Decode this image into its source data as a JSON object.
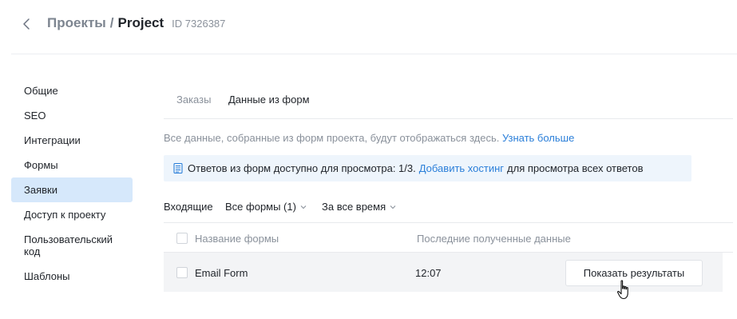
{
  "header": {
    "back_icon": "chevron-left-icon",
    "breadcrumb_parent": "Проекты",
    "breadcrumb_separator": "/",
    "breadcrumb_current": "Project",
    "project_id": "ID 7326387"
  },
  "sidebar": {
    "items": [
      {
        "label": "Общие",
        "active": false
      },
      {
        "label": "SEO",
        "active": false
      },
      {
        "label": "Интеграции",
        "active": false
      },
      {
        "label": "Формы",
        "active": false
      },
      {
        "label": "Заявки",
        "active": true
      },
      {
        "label": "Доступ к проекту",
        "active": false
      },
      {
        "label": "Пользовательский код",
        "active": false
      },
      {
        "label": "Шаблоны",
        "active": false
      }
    ]
  },
  "tabs": {
    "orders": "Заказы",
    "form_data": "Данные из форм",
    "active": "form_data"
  },
  "info": {
    "text": "Все данные, собранные из форм проекта, будут отображаться здесь.",
    "link": "Узнать больше"
  },
  "notice": {
    "icon": "form-document-icon",
    "text_before": "Ответов из форм доступно для просмотра: 1/3.",
    "link": "Добавить хостинг",
    "text_after": "для просмотра всех ответов"
  },
  "filters": {
    "incoming": "Входящие",
    "forms": "Все формы (1)",
    "period": "За все время"
  },
  "table": {
    "columns": [
      "Название формы",
      "Последние полученные данные"
    ],
    "rows": [
      {
        "name": "Email Form",
        "last_received": "12:07",
        "action": "Показать результаты"
      }
    ]
  },
  "colors": {
    "accent": "#2b7fd9",
    "sidebar_active": "#d6e8fb",
    "notice_bg": "#eef5fc",
    "row_bg": "#f3f4f6"
  }
}
